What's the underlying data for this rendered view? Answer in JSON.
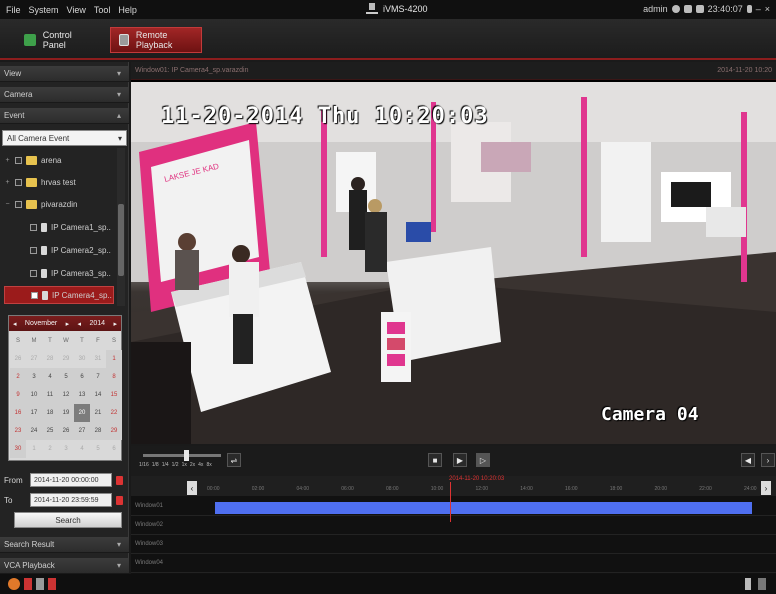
{
  "menubar": {
    "items": [
      "File",
      "System",
      "View",
      "Tool",
      "Help"
    ],
    "app_title": "iVMS-4200",
    "user": "admin",
    "clock": "23:40:07"
  },
  "tabs": [
    {
      "label": "Control Panel"
    },
    {
      "label": "Remote Playback"
    }
  ],
  "left_panel": {
    "sections": [
      "View",
      "Camera",
      "Event"
    ],
    "event_filter": "All Camera Event",
    "tree": [
      {
        "label": "arena",
        "type": "folder"
      },
      {
        "label": "hrvas test",
        "type": "folder"
      },
      {
        "label": "pivarazdin",
        "type": "folder"
      },
      {
        "label": "IP Camera1_sp..",
        "type": "camera"
      },
      {
        "label": "IP Camera2_sp..",
        "type": "camera"
      },
      {
        "label": "IP Camera3_sp..",
        "type": "camera"
      },
      {
        "label": "IP Camera4_sp..",
        "type": "camera",
        "selected": true
      }
    ],
    "calendar": {
      "month": "November",
      "year": "2014",
      "weekdays": [
        "S",
        "M",
        "T",
        "W",
        "T",
        "F",
        "S"
      ],
      "weeks": [
        [
          "26",
          "27",
          "28",
          "29",
          "30",
          "31",
          "1"
        ],
        [
          "2",
          "3",
          "4",
          "5",
          "6",
          "7",
          "8"
        ],
        [
          "9",
          "10",
          "11",
          "12",
          "13",
          "14",
          "15"
        ],
        [
          "16",
          "17",
          "18",
          "19",
          "20",
          "21",
          "22"
        ],
        [
          "23",
          "24",
          "25",
          "26",
          "27",
          "28",
          "29"
        ],
        [
          "30",
          "1",
          "2",
          "3",
          "4",
          "5",
          "6"
        ]
      ],
      "selected_day": "20"
    },
    "from_label": "From",
    "from_value": "2014-11-20 00:00:00",
    "to_label": "To",
    "to_value": "2014-11-20 23:59:59",
    "search_label": "Search",
    "bottom_sections": [
      "Search Result",
      "VCA Playback"
    ]
  },
  "video": {
    "header_left": "Window01: IP Camera4_sp.varazdin",
    "header_right": "2014-11-20 10:20",
    "osd_datetime": "11-20-2014 Thu 10:20:03",
    "osd_camera": "Camera 04"
  },
  "controls": {
    "speed_labels": [
      "1/16",
      "1/8",
      "1/4",
      "1/2",
      "1x",
      "2x",
      "4x",
      "8x"
    ],
    "speed_fraction": 0.55
  },
  "timeline": {
    "current_time": "2014-11-20 10:20:03",
    "tick_labels": [
      "00:00",
      "02:00",
      "04:00",
      "06:00",
      "08:00",
      "10:00",
      "12:00",
      "14:00",
      "16:00",
      "18:00",
      "20:00",
      "22:00",
      "24:00"
    ],
    "tracks": [
      "Window01",
      "Window02",
      "Window03",
      "Window04"
    ],
    "recording_color": "#4f6ff0",
    "cursor_color": "#dd3333"
  },
  "colors": {
    "accent": "#8c1d1d",
    "tab_active": "#a12626",
    "panel_bg": "#232323"
  }
}
